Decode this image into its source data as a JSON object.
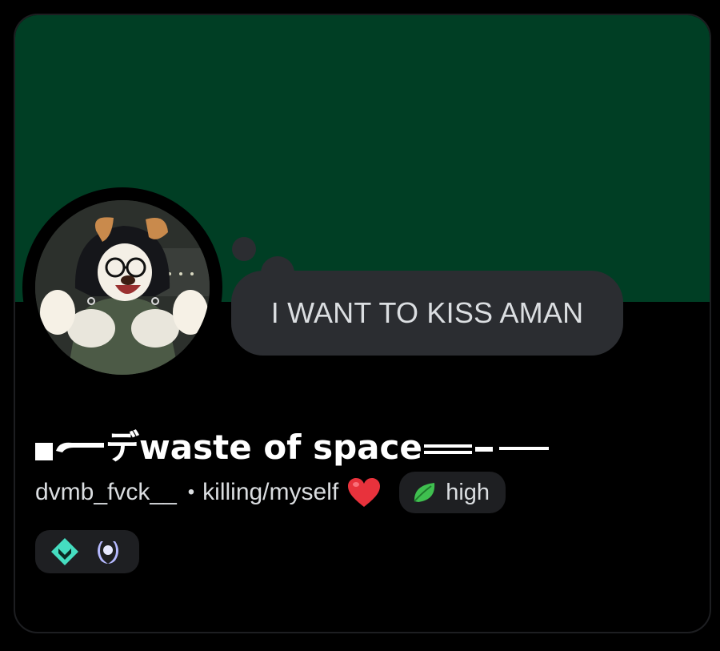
{
  "profile": {
    "display_name": "デwaste of space",
    "custom_status": "I WANT TO KISS AMAN",
    "username": "dvmb_fvck__",
    "separator": "•",
    "pronouns": "killing/myself",
    "tag_label": "high"
  },
  "icons": {
    "avatar": "anime-character-avatar",
    "heart": "red-heart-emoji",
    "tag_icon": "leaf-icon",
    "badge_1": "hypesquad-balance-badge",
    "badge_2": "quest-laurel-badge"
  },
  "colors": {
    "banner": "#003e24",
    "card_background": "#000000",
    "status_bubble": "#2b2d31",
    "tag_background": "#1e1f22",
    "text_primary": "#ffffff",
    "text_secondary": "#dbdee1",
    "heart": "#e8323c",
    "leaf": "#3fbf4f",
    "badge_balance": "#45ddc0",
    "badge_laurel": "#b5b9ff"
  }
}
